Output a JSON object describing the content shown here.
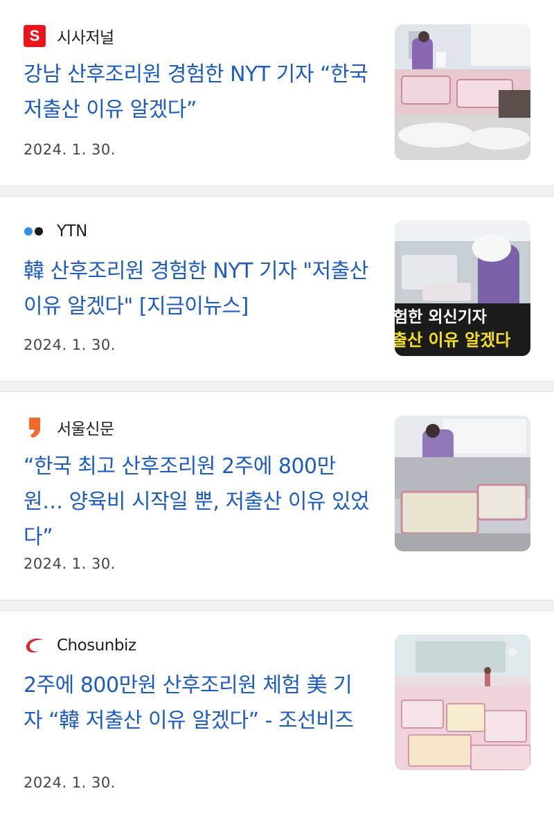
{
  "articles": [
    {
      "source": "시사저널",
      "logo_letter": "S",
      "logo_color": "#e8161c",
      "headline": "강남 산후조리원 경험한 NYT 기자 “한국 저출산 이유 알겠다”",
      "date": "2024. 1. 30.",
      "thumb_overlay": null
    },
    {
      "source": "YTN",
      "logo_color": "#2f8ff0",
      "headline": "韓 산후조리원 경험한 NYT 기자 \"저출산 이유 알겠다\" [지금이뉴스]",
      "date": "2024. 1. 30.",
      "thumb_overlay": {
        "line1": "험한 외신기자",
        "line2": "출산 이유 알겠다"
      }
    },
    {
      "source": "서울신문",
      "logo_color": "#f26a2a",
      "headline": "“한국 최고 산후조리원 2주에 800만원… 양육비 시작일 뿐, 저출산 이유 있었다”",
      "date": "2024. 1. 30."
    },
    {
      "source": "Chosunbiz",
      "logo_color": "#d8262d",
      "headline": "2주에 800만원 산후조리원 체험 美 기자 “韓 저출산 이유 알겠다” - 조선비즈",
      "date": "2024. 1. 30."
    }
  ],
  "colors": {
    "headline": "#1a5bc8",
    "background": "#eef0f2"
  }
}
